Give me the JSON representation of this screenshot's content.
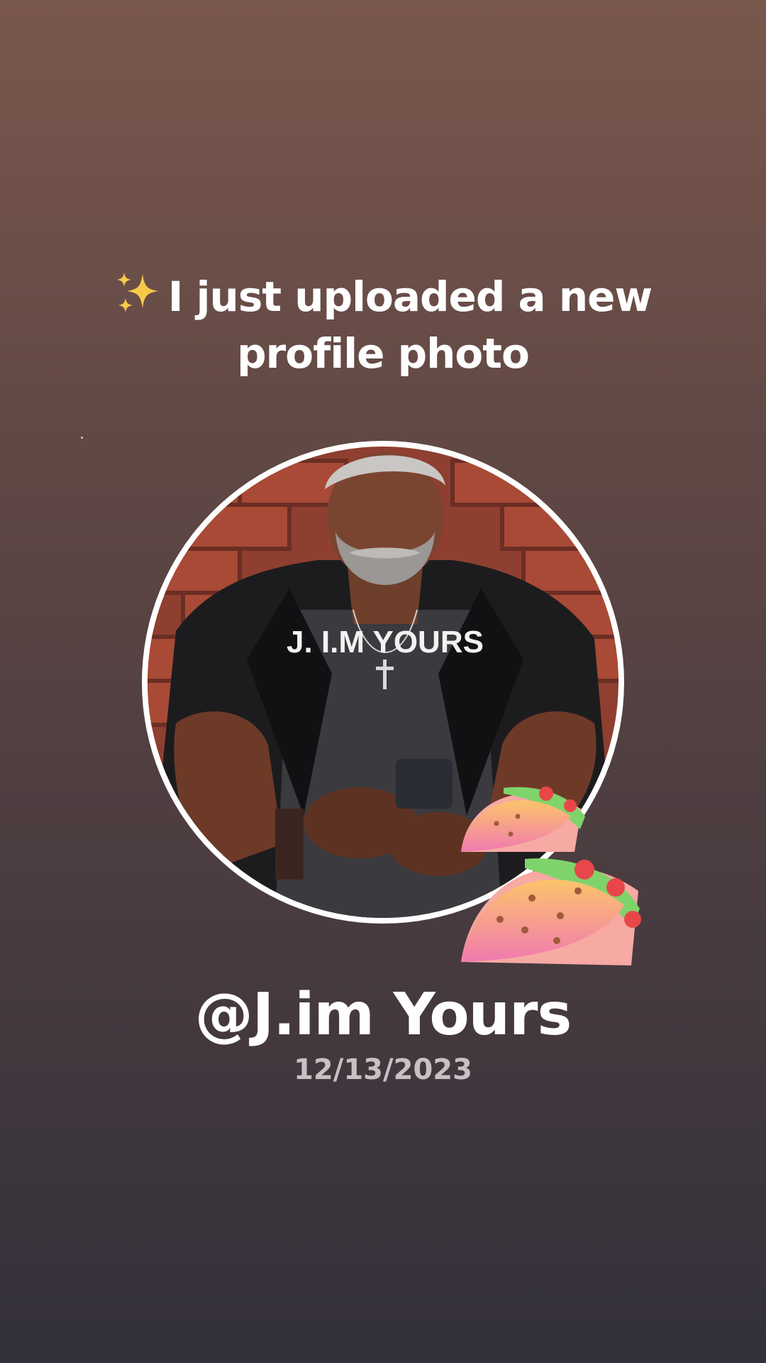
{
  "post": {
    "headline_icon": "sparkles-icon",
    "headline_line1": "I just uploaded a new",
    "headline_line2": "profile photo",
    "username": "@J.im Yours",
    "date": "12/13/2023"
  },
  "avatar": {
    "shirt_text": "J. I.M YOURS",
    "ring_color": "#ffffff"
  },
  "stickers": [
    "taco-icon",
    "taco-icon"
  ],
  "colors": {
    "background_top": "#7a574d",
    "background_bottom": "#33303b",
    "text_primary": "#ffffff",
    "text_secondary": "#c8c0c3"
  }
}
